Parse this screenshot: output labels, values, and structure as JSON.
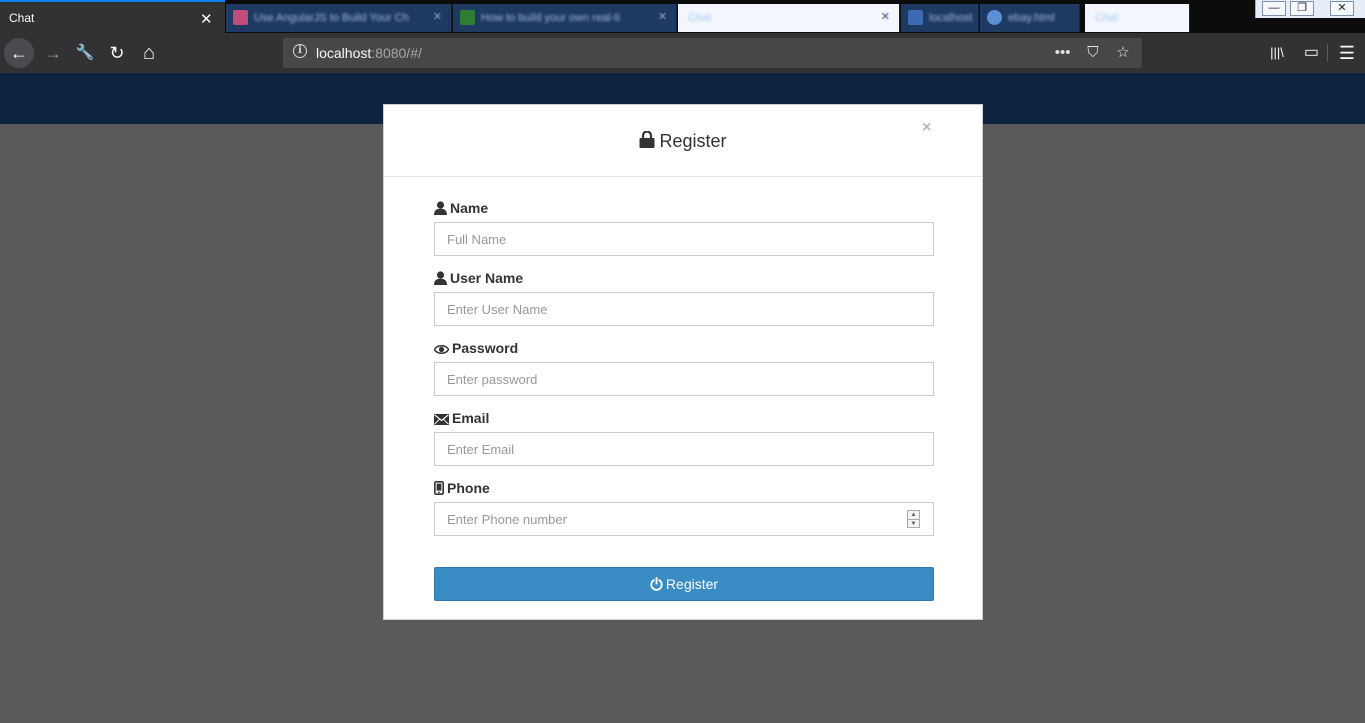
{
  "browser": {
    "active_tab": {
      "title": "Chat",
      "close_glyph": "✕"
    },
    "background_tabs": [
      {
        "title": "Use AngularJS to Build Your Ch",
        "close_glyph": "✕",
        "favicon_color": "#c44b7a"
      },
      {
        "title": "How to build your own real-ti",
        "close_glyph": "✕",
        "favicon_color": "#2e7d32"
      },
      {
        "title": "Chat",
        "close_glyph": "✕",
        "favicon_color": "#f3f7fd"
      },
      {
        "title": "localhost",
        "close_glyph": "✕",
        "favicon_color": "#3d6ab3"
      },
      {
        "title": "ebay.html",
        "close_glyph": "✕",
        "favicon_color": "#5b8fd6"
      },
      {
        "title": "Chat",
        "close_glyph": "✕",
        "favicon_color": "#f3f7fd"
      }
    ],
    "url": {
      "host": "localhost",
      "rest": ":8080/#/"
    },
    "url_actions": {
      "more": "•••",
      "pocket": "⛉",
      "bookmark": "☆"
    },
    "nav": {
      "back": "←",
      "forward": "→",
      "tools": "🔧",
      "reload": "↻",
      "home": "⌂"
    },
    "toolbar_right": {
      "library": "|||\\",
      "sidebar": "▭",
      "menu": "☰"
    },
    "window_controls": {
      "minimize": "—",
      "restore": "❐",
      "close": "✕"
    }
  },
  "colors": {
    "page_header": "#0e2340",
    "backdrop": "#5a5a5a",
    "button": "#3a8cc4"
  },
  "modal": {
    "title": "Register",
    "close_label": "×",
    "fields": {
      "name": {
        "label": "Name",
        "placeholder": "Full Name",
        "value": ""
      },
      "username": {
        "label": "User Name",
        "placeholder": "Enter User Name",
        "value": ""
      },
      "password": {
        "label": "Password",
        "placeholder": "Enter password",
        "value": ""
      },
      "email": {
        "label": "Email",
        "placeholder": "Enter Email",
        "value": ""
      },
      "phone": {
        "label": "Phone",
        "placeholder": "Enter Phone number",
        "value": ""
      }
    },
    "submit_label": "Register",
    "icons": {
      "title": "lock-icon",
      "name": "user-icon",
      "username": "user-icon",
      "password": "eye-icon",
      "email": "envelope-icon",
      "phone": "phone-icon",
      "submit": "power-icon"
    }
  }
}
